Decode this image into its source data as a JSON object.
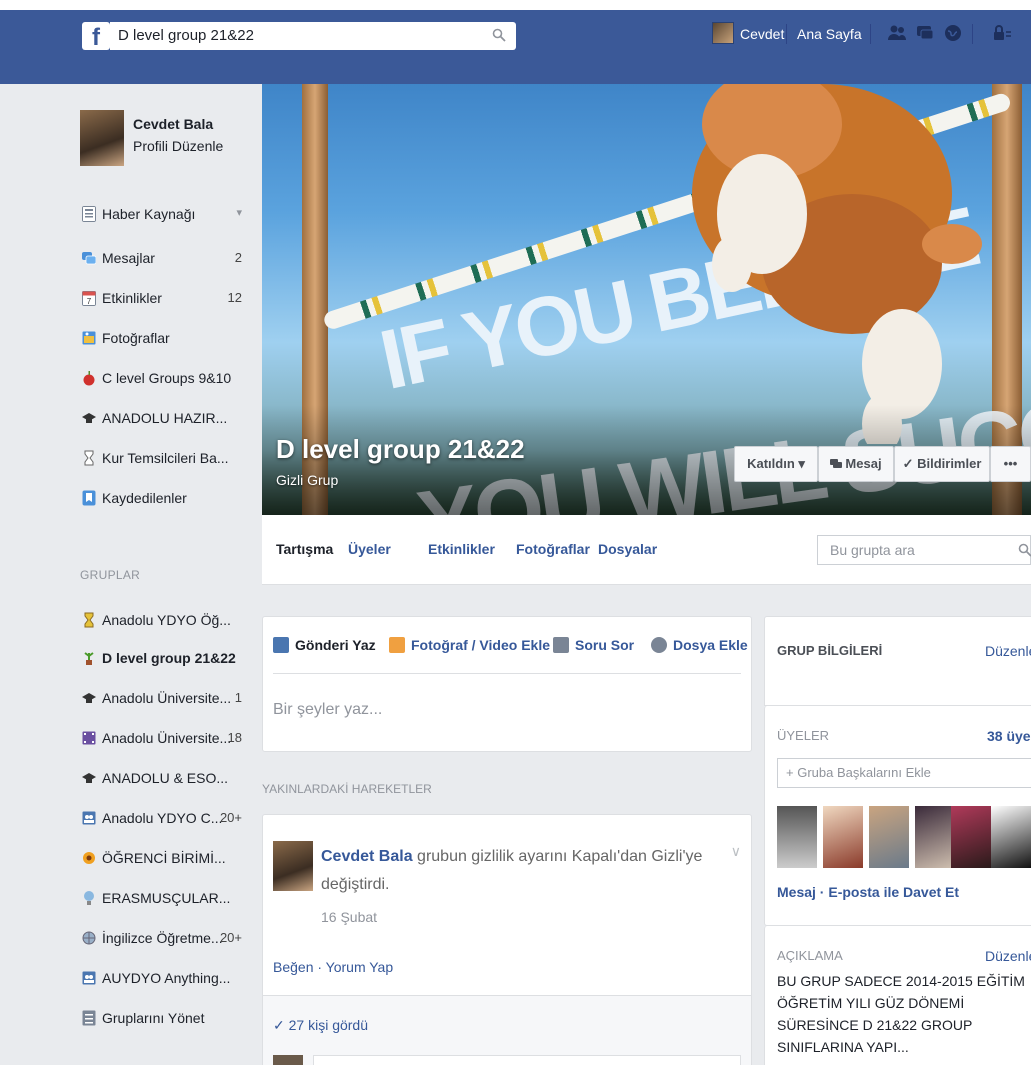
{
  "topbar": {
    "logo": "f",
    "search_value": "D level group 21&22",
    "user_name": "Cevdet",
    "home_label": "Ana Sayfa"
  },
  "profile": {
    "name": "Cevdet Bala",
    "edit": "Profili Düzenle"
  },
  "nav": [
    {
      "label": "Haber Kaynağı",
      "count": "▾"
    },
    {
      "label": "Mesajlar",
      "count": "2"
    },
    {
      "label": "Etkinlikler",
      "count": "12"
    },
    {
      "label": "Fotoğraflar",
      "count": ""
    },
    {
      "label": "C level Groups 9&10",
      "count": ""
    },
    {
      "label": "ANADOLU HAZIR...",
      "count": ""
    },
    {
      "label": "Kur Temsilcileri Ba...",
      "count": ""
    },
    {
      "label": "Kaydedilenler",
      "count": ""
    }
  ],
  "groups_header": "GRUPLAR",
  "groups": [
    {
      "label": "Anadolu YDYO Öğ...",
      "count": ""
    },
    {
      "label": "D level group 21&22",
      "count": ""
    },
    {
      "label": "Anadolu Üniversite...",
      "count": "1"
    },
    {
      "label": "Anadolu Üniversite...",
      "count": "18"
    },
    {
      "label": "ANADOLU & ESO...",
      "count": ""
    },
    {
      "label": "Anadolu YDYO C...",
      "count": "20+"
    },
    {
      "label": "ÖĞRENCİ BİRİMİ...",
      "count": ""
    },
    {
      "label": "ERASMUSÇULAR...",
      "count": ""
    },
    {
      "label": "İngilizce Öğretme...",
      "count": "20+"
    },
    {
      "label": "AUYDYO Anything...",
      "count": ""
    },
    {
      "label": "Gruplarını Yönet",
      "count": ""
    }
  ],
  "cover": {
    "line1": "IF YOU BELIEVE",
    "line2": "YOU WILL SUCCEED",
    "group_title": "D level group 21&22",
    "group_privacy": "Gizli Grup",
    "btn_joined": "Katıldın ▾",
    "btn_message": "Mesaj",
    "btn_notifications": "✓ Bildirimler",
    "btn_more": "•••"
  },
  "tabs": {
    "items": [
      "Tartışma",
      "Üyeler",
      "Etkinlikler",
      "Fotoğraflar",
      "Dosyalar"
    ],
    "search_placeholder": "Bu grupta ara"
  },
  "composer": {
    "tabs": [
      "Gönderi Yaz",
      "Fotoğraf / Video Ekle",
      "Soru Sor",
      "Dosya Ekle"
    ],
    "placeholder": "Bir şeyler yaz..."
  },
  "recent_header": "YAKINLARDAKİ HAREKETLER",
  "post": {
    "author": "Cevdet Bala",
    "text": " grubun gizlilik ayarını Kapalı'dan Gizli'ye değiştirdi.",
    "date": "16 Şubat",
    "actions": "Beğen · Yorum Yap",
    "seen": "✓ 27 kişi gördü"
  },
  "info": {
    "header": "GRUP BİLGİLERİ",
    "edit": "Düzenle",
    "members_label": "ÜYELER",
    "members_count": "38 üye",
    "add_placeholder": "+ Gruba Başkalarını Ekle",
    "links": "Mesaj · E-posta ile Davet Et",
    "desc_label": "AÇIKLAMA",
    "desc_edit": "Düzenle",
    "desc_text": "BU GRUP SADECE 2014-2015 EĞİTİM ÖĞRETİM YILI GÜZ DÖNEMİ SÜRESİNCE D 21&22 GROUP SINIFLARINA YAPI..."
  },
  "colors": {
    "brand": "#3b5998",
    "link": "#365899",
    "muted": "#90949c",
    "background": "#e9ebee"
  }
}
